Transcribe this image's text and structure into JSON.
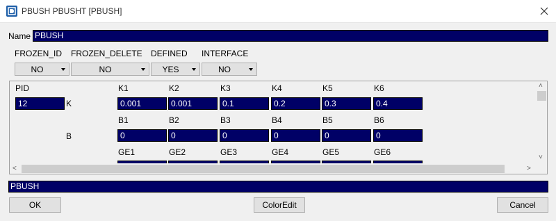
{
  "window": {
    "title": "PBUSH PBUSHT [PBUSH]"
  },
  "name_field": {
    "label": "Name",
    "value": "PBUSH"
  },
  "flags": [
    {
      "label": "FROZEN_ID",
      "value": "NO"
    },
    {
      "label": "FROZEN_DELETE",
      "value": "NO"
    },
    {
      "label": "DEFINED",
      "value": "YES"
    },
    {
      "label": "INTERFACE",
      "value": "NO"
    }
  ],
  "pid": {
    "label": "PID",
    "value": "12"
  },
  "rows": [
    {
      "row_label": "K",
      "headers": [
        "K1",
        "K2",
        "K3",
        "K4",
        "K5",
        "K6"
      ],
      "values": [
        "0.001",
        "0.001",
        "0.1",
        "0.2",
        "0.3",
        "0.4"
      ]
    },
    {
      "row_label": "B",
      "headers": [
        "B1",
        "B2",
        "B3",
        "B4",
        "B5",
        "B6"
      ],
      "values": [
        "0",
        "0",
        "0",
        "0",
        "0",
        "0"
      ]
    },
    {
      "row_label": "",
      "headers": [
        "GE1",
        "GE2",
        "GE3",
        "GE4",
        "GE5",
        "GE6"
      ],
      "values": [
        "",
        "",
        "",
        "",
        "",
        ""
      ]
    }
  ],
  "status_field": {
    "value": "PBUSH"
  },
  "buttons": {
    "ok": "OK",
    "color_edit": "ColorEdit",
    "cancel": "Cancel"
  },
  "colors": {
    "field_bg": "#000066",
    "field_text": "#ffffff",
    "dialog_bg": "#f0f0f0"
  }
}
